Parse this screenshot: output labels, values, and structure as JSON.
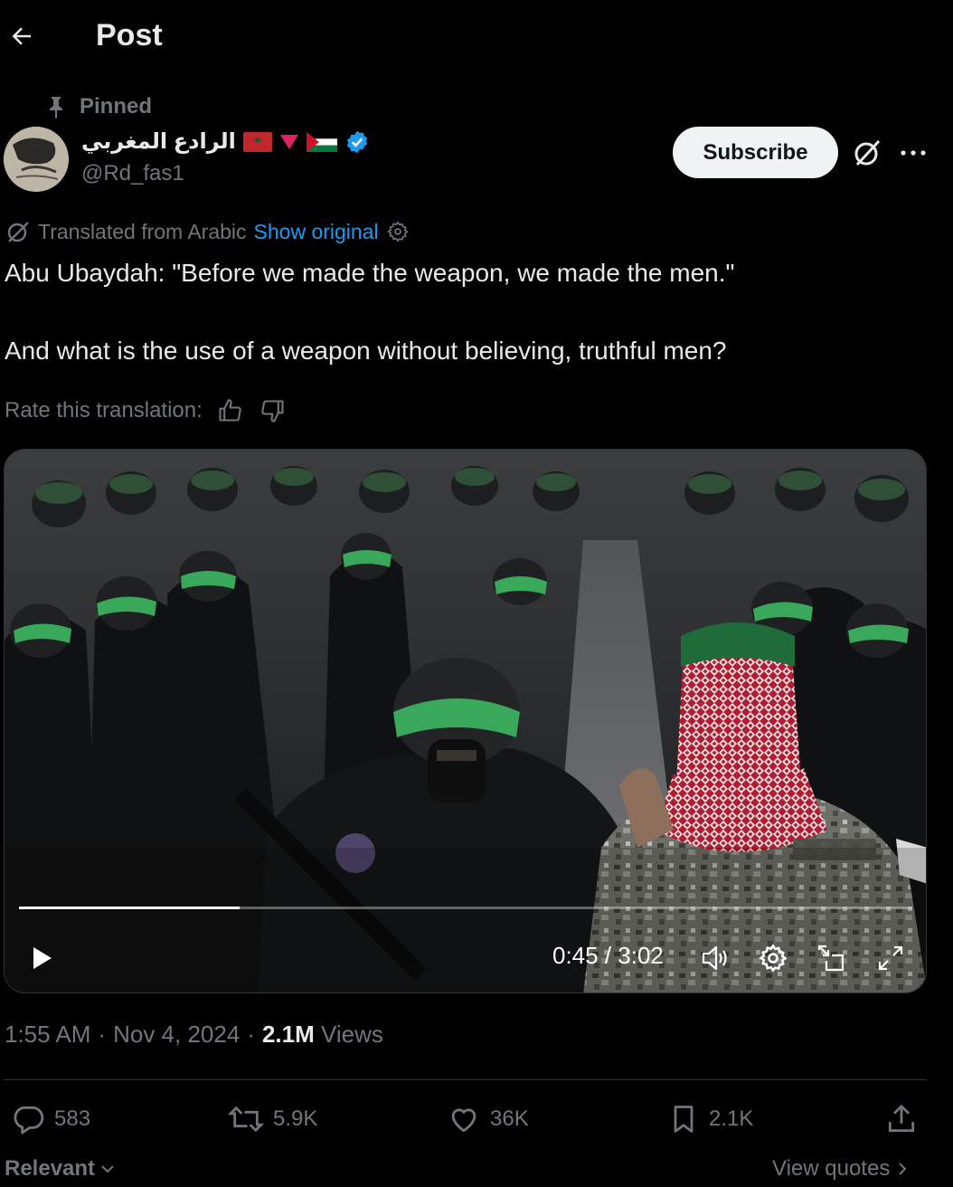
{
  "header": {
    "title": "Post"
  },
  "post": {
    "pinned_label": "Pinned",
    "author": {
      "display_name": "الرادع المغربي",
      "handle": "@Rd_fas1",
      "badges": [
        "morocco-flag",
        "red-triangle",
        "palestine-flag",
        "verified-badge"
      ]
    },
    "subscribe_label": "Subscribe",
    "translation": {
      "label": "Translated from Arabic",
      "show_original": "Show original"
    },
    "text_line_1": "Abu Ubaydah: \"Before we made the weapon, we made the men.\"",
    "text_line_2": "And what is the use of a weapon without believing, truthful men?",
    "rate_label": "Rate this translation:",
    "video": {
      "time": "0:45 / 3:02",
      "progress": 0.247
    },
    "meta": {
      "time": "1:55 AM",
      "date": "Nov 4, 2024",
      "views_count": "2.1M",
      "views_label": "Views"
    },
    "actions": {
      "replies": "583",
      "reposts": "5.9K",
      "likes": "36K",
      "bookmarks": "2.1K"
    },
    "footer": {
      "sort_label": "Relevant",
      "view_quotes": "View quotes"
    }
  },
  "colors": {
    "background": "#000000",
    "text": "#e7e9ea",
    "secondary": "#71767b",
    "link": "#1d9bf0",
    "verified": "#1d9bf0",
    "divider": "#2f3336"
  }
}
